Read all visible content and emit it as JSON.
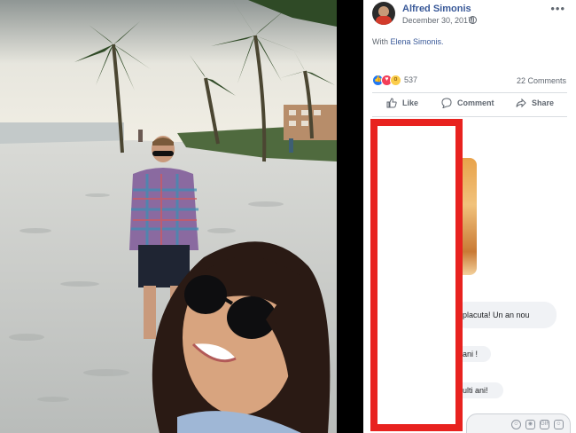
{
  "post": {
    "author": "Alfred Simonis",
    "date": "December 30, 2017",
    "with_prefix": "With",
    "with_name": "Elena Simonis.",
    "reaction_count": "537",
    "comments_count": "22 Comments"
  },
  "actions": {
    "like": "Like",
    "comment": "Comment",
    "share": "Share"
  },
  "comments": [
    {
      "text": "placuta! Un an nou"
    },
    {
      "text": "ani !"
    },
    {
      "text": "ulti ani!"
    }
  ],
  "composer": {
    "icons": [
      "emoji-icon",
      "camera-icon",
      "gif-icon",
      "sticker-icon"
    ],
    "gif_label": "GIF"
  },
  "colors": {
    "link_blue": "#385898",
    "redaction_red": "#e8221f",
    "like_blue": "#2078f4",
    "love_red": "#f33e58",
    "wow_yellow": "#fbcd4b"
  }
}
